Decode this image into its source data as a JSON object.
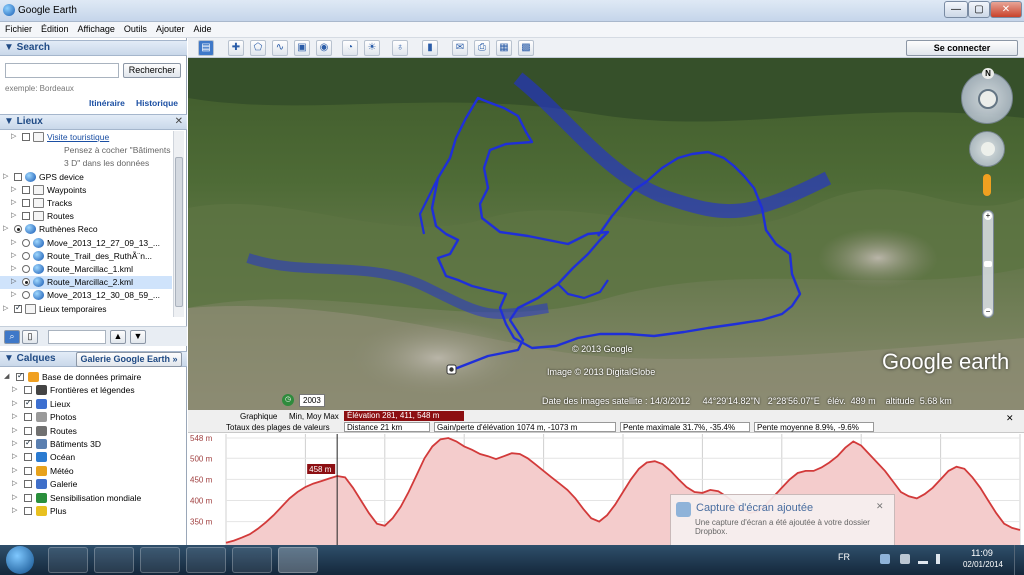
{
  "window": {
    "title": "Google Earth",
    "minimize": "—",
    "maximize": "▢",
    "close": "✕"
  },
  "menu": [
    "Fichier",
    "Édition",
    "Affichage",
    "Outils",
    "Ajouter",
    "Aide"
  ],
  "search": {
    "header": "▼ Search",
    "button": "Rechercher",
    "hint": "exemple: Bordeaux",
    "link_itinerary": "Itinéraire",
    "link_history": "Historique"
  },
  "places": {
    "header": "▼ Lieux",
    "items": [
      {
        "label": "Visite touristique",
        "type": "folder",
        "checked": false,
        "link": true
      },
      {
        "label": "Pensez à cocher \"Bâtiments",
        "type": "note"
      },
      {
        "label": "3 D\" dans les données",
        "type": "note"
      },
      {
        "label": "GPS device",
        "type": "globe",
        "checked": false
      },
      {
        "label": "Waypoints",
        "type": "folder",
        "checked": false
      },
      {
        "label": "Tracks",
        "type": "folder",
        "checked": false
      },
      {
        "label": "Routes",
        "type": "folder",
        "checked": false
      },
      {
        "label": "Ruthènes Reco",
        "type": "globe",
        "radio": true,
        "on": true
      },
      {
        "label": "Move_2013_12_27_09_13_...",
        "type": "globe",
        "radio": true,
        "on": false
      },
      {
        "label": "Route_Trail_des_RuthÃ¨n...",
        "type": "globe",
        "radio": true,
        "on": false
      },
      {
        "label": "Route_Marcillac_1.kml",
        "type": "globe",
        "radio": true,
        "on": false
      },
      {
        "label": "Route_Marcillac_2.kml",
        "type": "globe",
        "radio": true,
        "on": true,
        "selected": true
      },
      {
        "label": "Move_2013_12_30_08_59_...",
        "type": "globe",
        "radio": true,
        "on": false
      },
      {
        "label": "Lieux temporaires",
        "type": "folder",
        "checked": true
      }
    ]
  },
  "layers": {
    "header": "▼ Calques",
    "gallery_button": "Galerie Google Earth »",
    "items": [
      {
        "label": "Base de données primaire",
        "checked": true,
        "color": "#f0a020"
      },
      {
        "label": "Frontières et légendes",
        "checked": false,
        "color": "#444444"
      },
      {
        "label": "Lieux",
        "checked": true,
        "color": "#3c6fd0"
      },
      {
        "label": "Photos",
        "checked": false,
        "color": "#9a9a9a"
      },
      {
        "label": "Routes",
        "checked": false,
        "color": "#707070"
      },
      {
        "label": "Bâtiments 3D",
        "checked": true,
        "color": "#5a7fb0"
      },
      {
        "label": "Océan",
        "checked": false,
        "color": "#2b7bd1"
      },
      {
        "label": "Météo",
        "checked": false,
        "color": "#e7a21c"
      },
      {
        "label": "Galerie",
        "checked": false,
        "color": "#3f6fc9"
      },
      {
        "label": "Sensibilisation mondiale",
        "checked": false,
        "color": "#2a8f3c"
      },
      {
        "label": "Plus",
        "checked": false,
        "color": "#e8c020"
      }
    ]
  },
  "toolbar": {
    "connect_button": "Se connecter"
  },
  "map": {
    "copyright1": "© 2013 Google",
    "copyright2": "Image © 2013 DigitalGlobe",
    "year": "2003",
    "status": "Date des images satellite : 14/3/2012",
    "lat": "44°29'14.82\"N",
    "lon": "2°28'56.07\"E",
    "elev_label": "élév.",
    "elev": "489 m",
    "alt_label": "altitude",
    "alt": "5.68 km",
    "logo": "Google earth",
    "compass_n": "N",
    "track_color": "#1f2fd8"
  },
  "profile": {
    "row1": {
      "graph_label": "Graphique",
      "modes": "Min, Moy  Max",
      "elevation": "Élévation   281, 411, 548 m"
    },
    "row2": {
      "totals_label": "Totaux des plages de valeurs",
      "distance": "Distance   21 km",
      "gain": "Gain/perte d'élévation   1074 m, -1073 m",
      "max_slope": "Pente maximale   31.7%, -35.4%",
      "avg_slope": "Pente moyenne   8.9%, -9.6%"
    },
    "cursor_label": "458 m",
    "y_ticks": [
      "548 m",
      "500 m",
      "450 m",
      "400 m",
      "350 m"
    ]
  },
  "chart_data": {
    "type": "area",
    "title": "",
    "xlabel": "",
    "ylabel": "",
    "ylim": [
      330,
      548
    ],
    "y_ticks": [
      548,
      500,
      450,
      400,
      350
    ],
    "series": [
      {
        "x": [
          0,
          1,
          2,
          3,
          4,
          5,
          6,
          7,
          8,
          9,
          10,
          11,
          12,
          13,
          14,
          15,
          16,
          17,
          18,
          19,
          20,
          21,
          22,
          23,
          24,
          25,
          26,
          27,
          28,
          29,
          30,
          31,
          32,
          33,
          34,
          35,
          36,
          37,
          38,
          39,
          40,
          41,
          42,
          43,
          44,
          45,
          46,
          47,
          48,
          49,
          50,
          51,
          52,
          53,
          54,
          55,
          56,
          57,
          58,
          59,
          60,
          61,
          62,
          63,
          64,
          65,
          66,
          67,
          68,
          69,
          70,
          71,
          72,
          73,
          74,
          75,
          76,
          77,
          78,
          79,
          80,
          81,
          82,
          83,
          84,
          85,
          86,
          87,
          88,
          89,
          90,
          91,
          92,
          93,
          94,
          95,
          96,
          97,
          98,
          99,
          100
        ],
        "values": [
          300,
          305,
          312,
          320,
          333,
          348,
          365,
          385,
          405,
          420,
          432,
          440,
          446,
          452,
          458,
          455,
          430,
          400,
          370,
          345,
          340,
          358,
          385,
          420,
          460,
          500,
          528,
          545,
          548,
          540,
          528,
          520,
          510,
          505,
          498,
          505,
          512,
          510,
          500,
          485,
          470,
          455,
          440,
          425,
          405,
          380,
          358,
          350,
          365,
          390,
          420,
          450,
          475,
          490,
          493,
          486,
          470,
          450,
          432,
          420,
          418,
          425,
          422,
          410,
          395,
          380,
          370,
          375,
          390,
          410,
          430,
          450,
          465,
          470,
          470,
          478,
          490,
          505,
          525,
          540,
          530,
          510,
          490,
          470,
          445,
          420,
          410,
          405,
          415,
          430,
          450,
          470,
          480,
          475,
          455,
          430,
          400,
          370,
          345,
          335,
          330
        ]
      }
    ]
  },
  "notification": {
    "title": "Capture d'écran ajoutée",
    "text": "Une capture d'écran a été ajoutée à votre dossier Dropbox."
  },
  "taskbar": {
    "lang": "FR",
    "time": "11:09",
    "date": "02/01/2014"
  }
}
